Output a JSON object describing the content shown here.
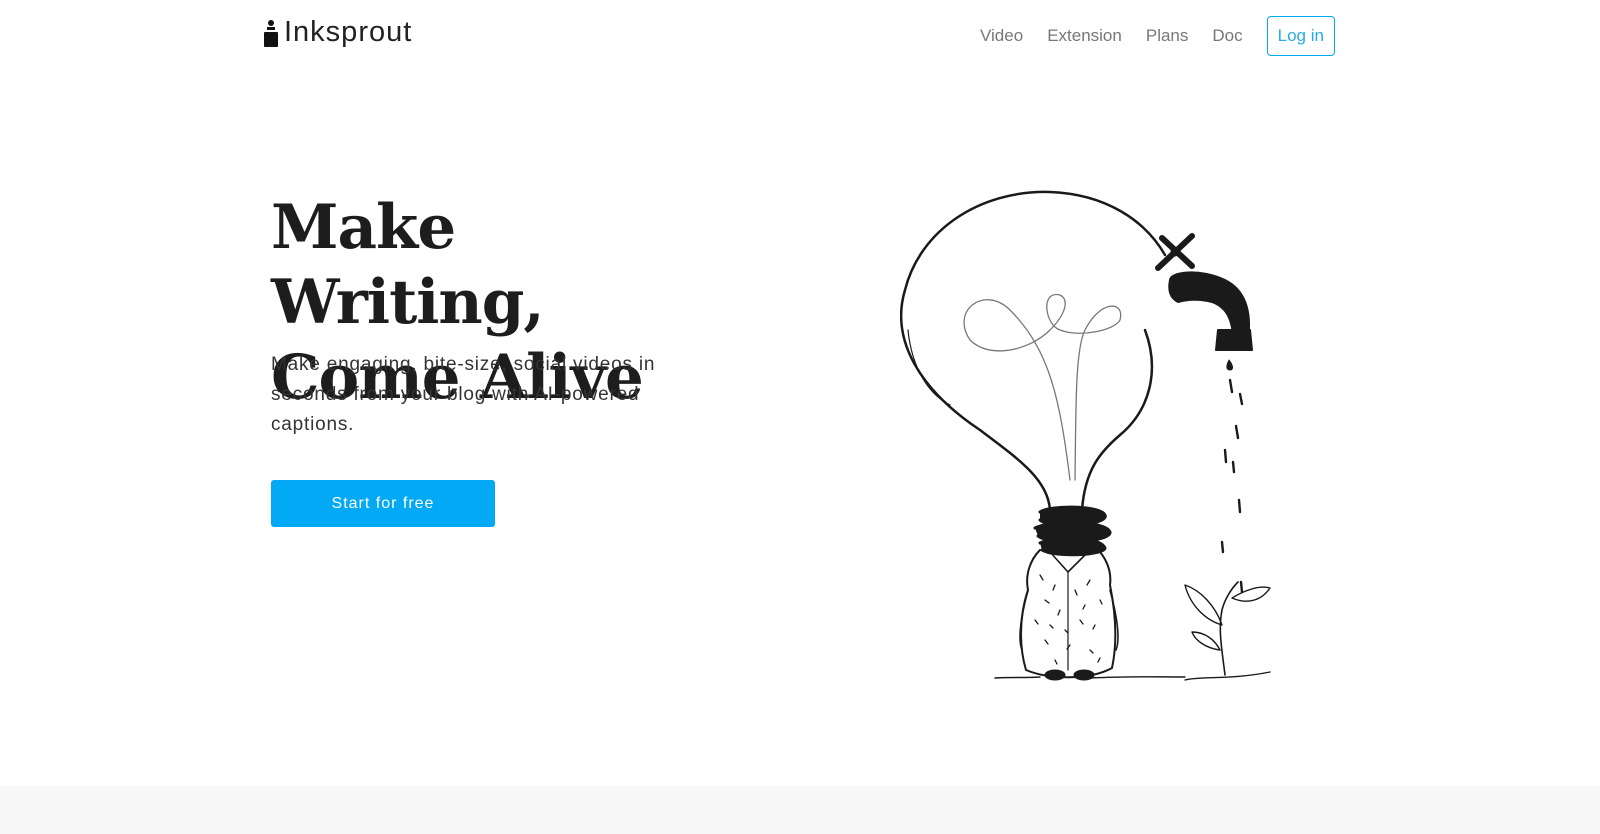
{
  "brand": {
    "name": "Inksprout"
  },
  "nav": {
    "links": [
      "Video",
      "Extension",
      "Plans",
      "Doc"
    ],
    "login_label": "Log in"
  },
  "hero": {
    "title_line1": "Make Writing,",
    "title_line2": "Come Alive",
    "subtitle": "Make engaging, bite-size, social videos in seconds from your blog with AI-powered captions.",
    "cta_label": "Start for free"
  },
  "colors": {
    "accent": "#03a9f4",
    "text": "#1d1d1d",
    "nav_text": "#777777",
    "footer_bg": "#f7f7f7"
  },
  "icons": {
    "logo": "ink-bottle-icon",
    "illustration": "lightbulb-faucet-sprout-illustration"
  }
}
